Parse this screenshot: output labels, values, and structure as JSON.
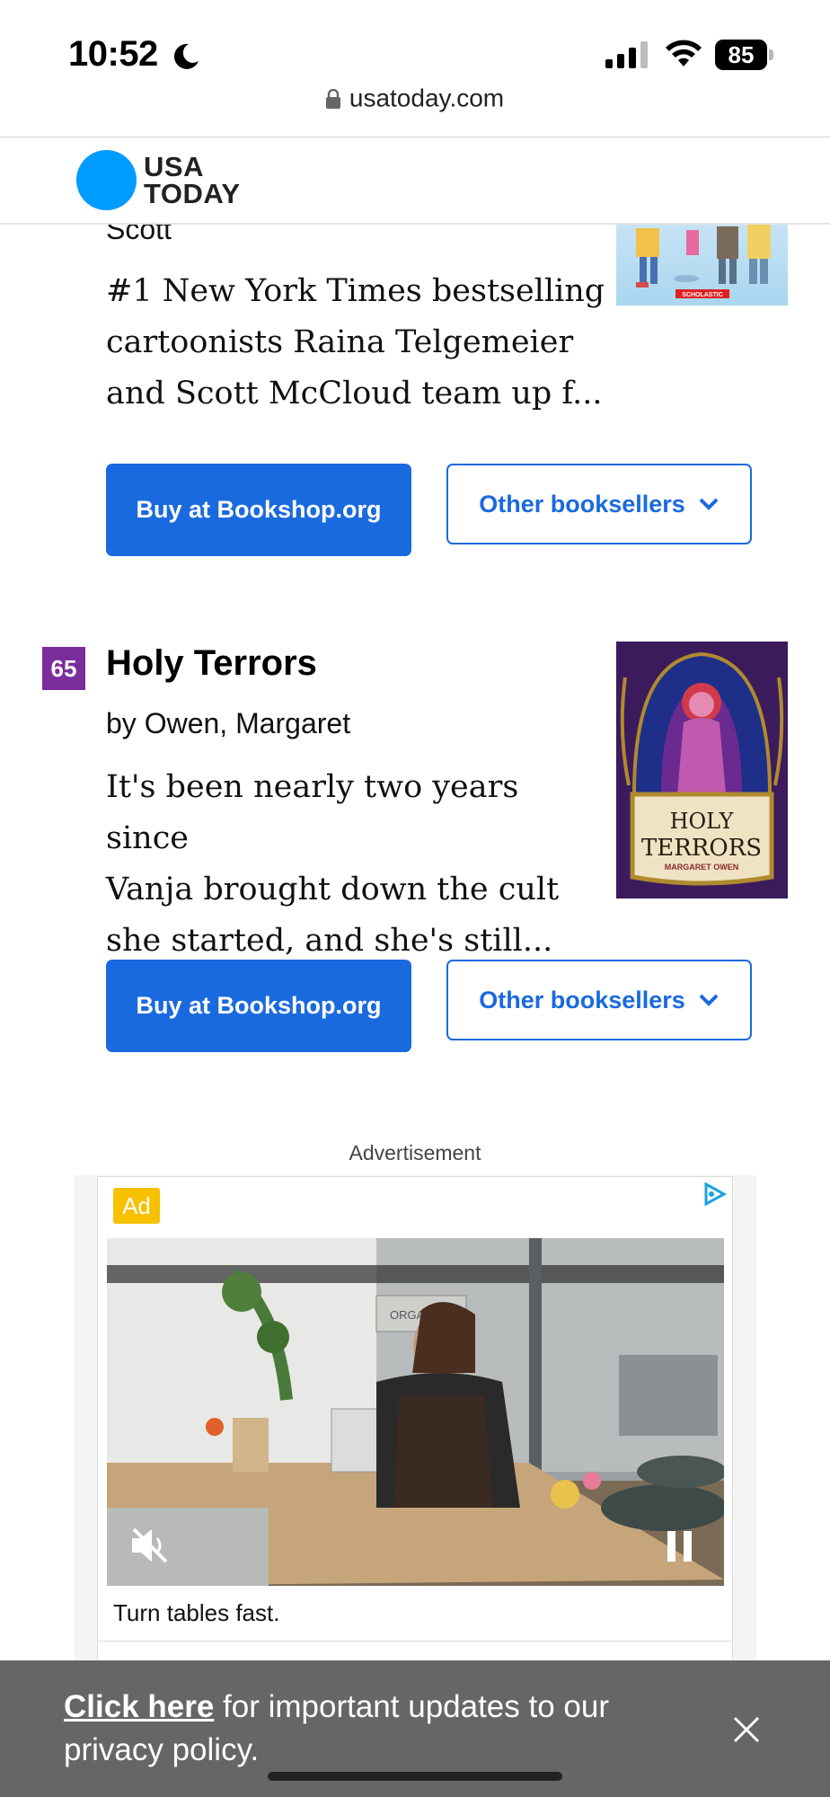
{
  "status_bar": {
    "time": "10:52",
    "battery": "85"
  },
  "browser": {
    "url": "usatoday.com"
  },
  "site": {
    "logo_line1": "USA",
    "logo_line2": "TODAY"
  },
  "prev_book": {
    "author_partial": "Scott",
    "description": [
      "#1 New York Times bestselling",
      "cartoonists Raina Telgemeier",
      "and Scott McCloud team up f..."
    ],
    "buy_label": "Buy at Bookshop.org",
    "other_label": "Other booksellers",
    "cover_publisher": "SCHOLASTIC"
  },
  "book": {
    "rank": "65",
    "title": "Holy Terrors",
    "author": "by Owen, Margaret",
    "description": [
      "It's been nearly two years since",
      "Vanja brought down the cult",
      "she started, and she's still..."
    ],
    "buy_label": "Buy at Bookshop.org",
    "other_label": "Other booksellers",
    "cover_title_1": "HOLY",
    "cover_title_2": "TERRORS",
    "cover_author": "MARGARET OWEN"
  },
  "ad": {
    "label": "Advertisement",
    "badge": "Ad",
    "caption": "Turn tables fast.",
    "sign_text": "ORGANIC G"
  },
  "privacy_banner": {
    "link_text": "Click here",
    "text": " for important updates to our privacy policy."
  },
  "colors": {
    "accent": "#1a6adf",
    "rank_badge": "#7b2d9b",
    "logo": "#009bff",
    "ad_badge": "#f7c100"
  }
}
